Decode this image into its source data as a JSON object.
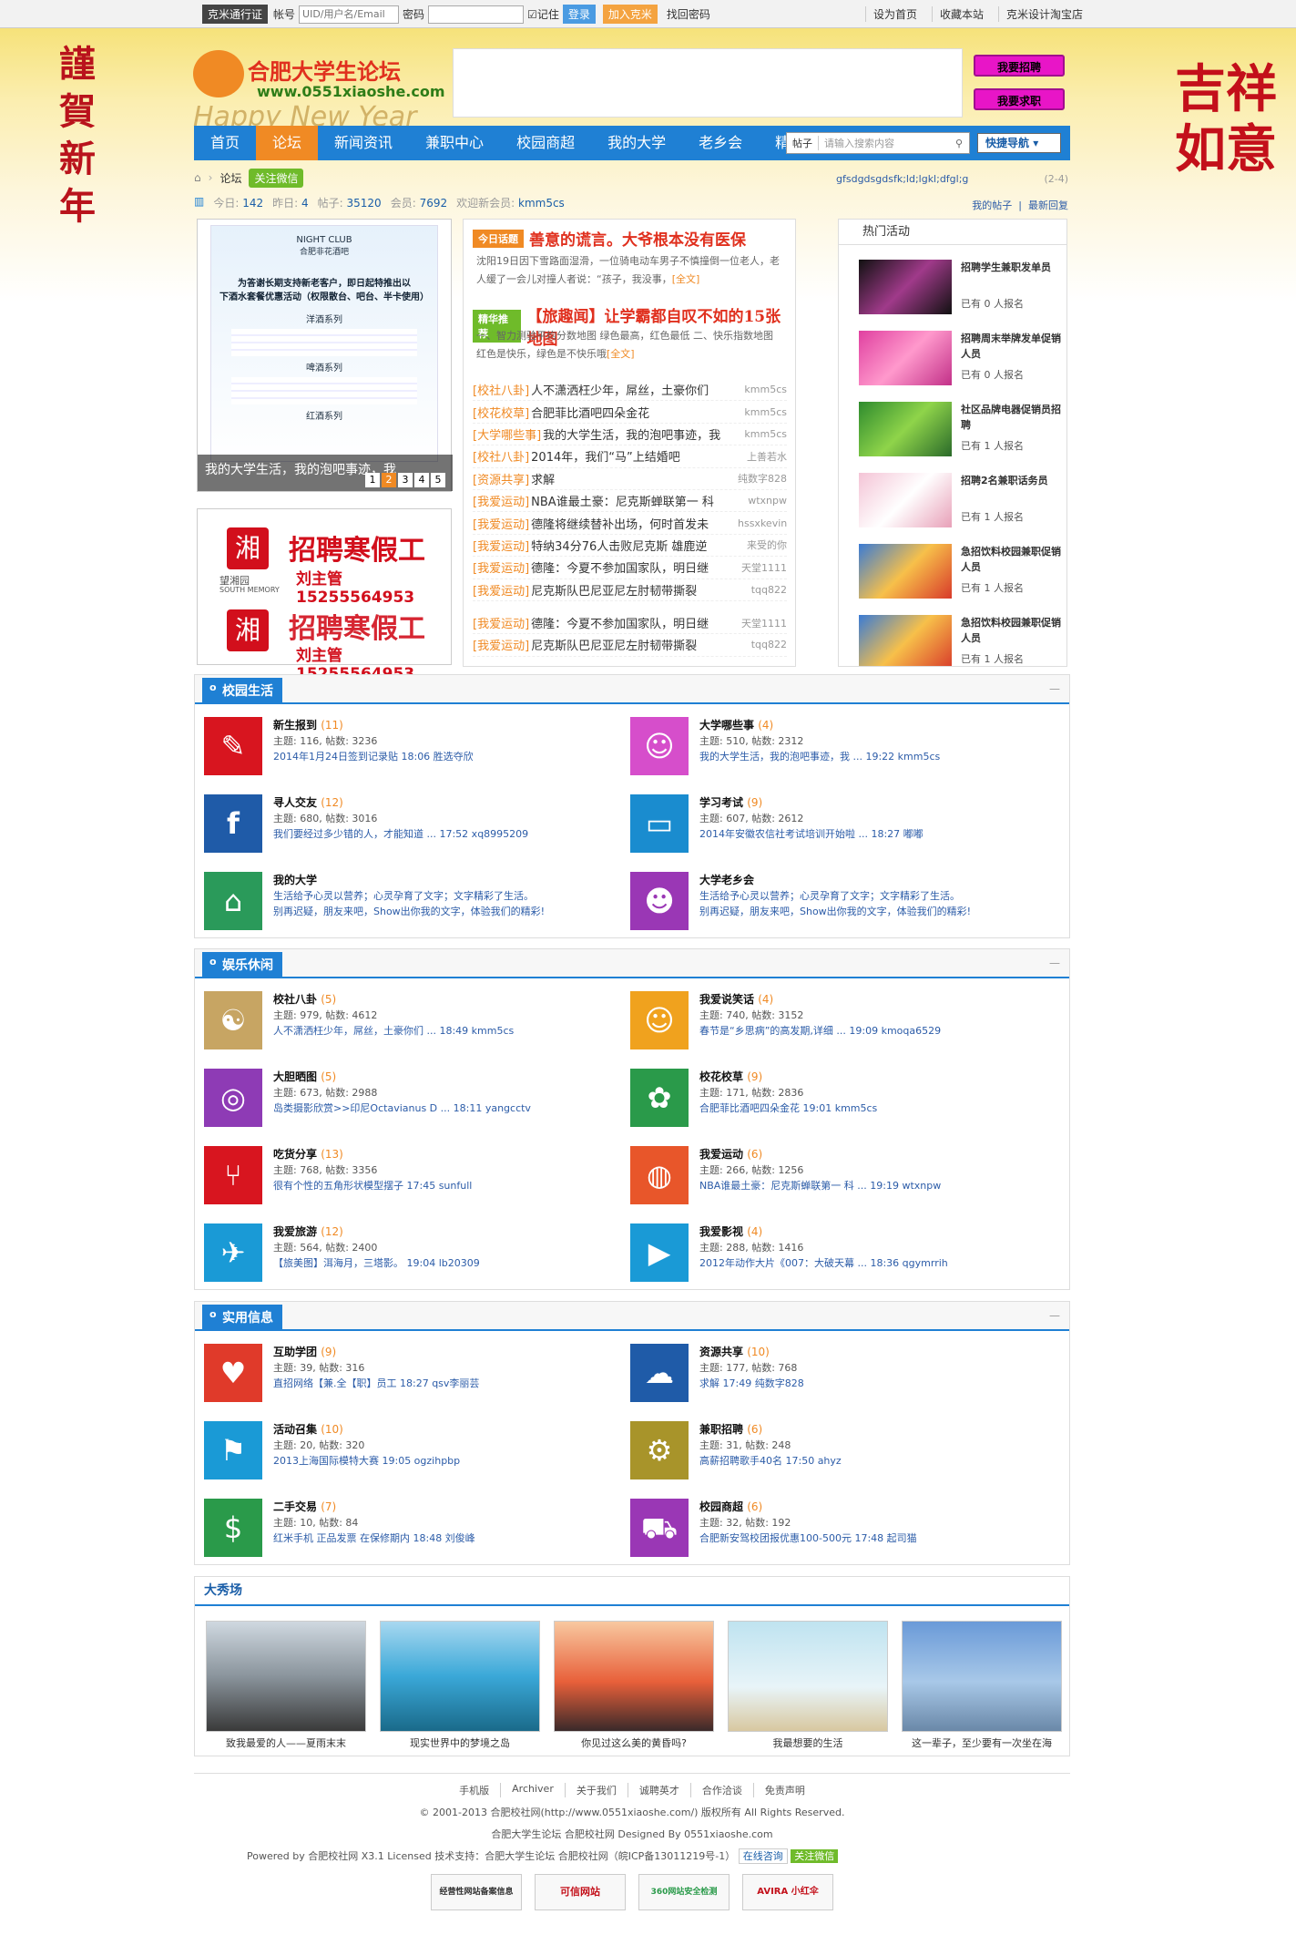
{
  "topbar": {
    "tag": "克米通行证",
    "account_label": "帐号",
    "account_placeholder": "UID/用户名/Email",
    "password_label": "密码",
    "remember": "记住",
    "login": "登录",
    "join": "加入克米",
    "find_password": "找回密码",
    "right_links": [
      "设为首页",
      "收藏本站",
      "克米设计淘宝店"
    ]
  },
  "header": {
    "logo_title": "合肥大学生论坛",
    "logo_url": "www.0551xiaoshe.com",
    "logo_happy": "Happy New Year",
    "hire_button": "我要招聘",
    "job_button": "我要求职",
    "left_deco": "謹賀新年",
    "right_deco": "吉祥如意"
  },
  "nav": {
    "items": [
      "首页",
      "论坛",
      "新闻资讯",
      "兼职中心",
      "校园商超",
      "我的大学",
      "老乡会",
      "精彩"
    ],
    "active": 1,
    "search_scope": "帖子",
    "search_placeholder": "请输入搜索内容",
    "quick_nav": "快捷导航"
  },
  "breadcrumb": {
    "current": "论坛",
    "wechat": "关注微信"
  },
  "stats": {
    "today_label": "今日:",
    "today": "142",
    "yesterday_label": "昨日:",
    "yesterday": "4",
    "posts_label": "帖子:",
    "posts": "35120",
    "members_label": "会员:",
    "members": "7692",
    "welcome": "欢迎新会员:",
    "new_member": "kmm5cs"
  },
  "right_top": {
    "notice": "gfsdgdsgdsfk;ld;lgkl;dfgl;g",
    "notice_date": "(2-4)",
    "links": [
      "我的帖子",
      "最新回复"
    ]
  },
  "slide": {
    "caption": "我的大学生活，我的泡吧事迹，我",
    "pages": [
      "1",
      "2",
      "3",
      "4",
      "5"
    ],
    "active": 1,
    "flyer_lines": [
      "NIGHT CLUB",
      "合肥非花酒吧",
      "为答谢长期支持新老客户，即日起特推出以",
      "下酒水套餐优惠活动（权限散台、吧台、半卡使用）",
      "洋酒系列",
      "啤酒系列",
      "红酒系列"
    ]
  },
  "ad": {
    "brand": "望湘园",
    "brand_en": "SOUTH MEMORY",
    "title": "招聘寒假工",
    "contact": "刘主管15255564953"
  },
  "hot": {
    "topic_tag": "今日话题",
    "topic_title": "善意的谎言。大爷根本没有医保",
    "topic_summary": "沈阳19日因下雪路面湿滑，一位骑电动车男子不慎撞倒一位老人，老人缓了一会儿对撞人者说：“孩子，我没事，",
    "full": "[全文]",
    "feature_tag": "精华推荐",
    "feature_title": "【旅趣闻】让学霸都自叹不如的15张地图",
    "feature_summary": "一、智力测验平均分数地图 绿色最高，红色最低 二、快乐指数地图 红色是快乐，绿色是不快乐哦",
    "list": [
      {
        "cat": "[校社八卦]",
        "title": "人不潇洒枉少年，屌丝，土豪你们",
        "author": "kmm5cs"
      },
      {
        "cat": "[校花校草]",
        "title": "合肥菲比酒吧四朵金花",
        "author": "kmm5cs"
      },
      {
        "cat": "[大学哪些事]",
        "title": "我的大学生活，我的泡吧事迹，我",
        "author": "kmm5cs"
      },
      {
        "cat": "[校社八卦]",
        "title": "2014年，我们“马”上结婚吧",
        "author": "上善若水"
      },
      {
        "cat": "[资源共享]",
        "title": "求解",
        "author": "纯数字828"
      },
      {
        "cat": "[我爱运动]",
        "title": "NBA谁最土豪：尼克斯蝉联第一 科",
        "author": "wtxnpw"
      },
      {
        "cat": "[我爱运动]",
        "title": "德隆将继续替补出场，何时首发未",
        "author": "hssxkevin"
      },
      {
        "cat": "[我爱运动]",
        "title": "特纳34分76人击败尼克斯 雄鹿逆",
        "author": "来受的你"
      },
      {
        "cat": "[我爱运动]",
        "title": "德隆：今夏不参加国家队，明日继",
        "author": "天堂1111"
      },
      {
        "cat": "[我爱运动]",
        "title": "尼克斯队巴尼亚尼左肘韧带撕裂",
        "author": "tqq822"
      },
      {
        "cat": "[我爱运动]",
        "title": "德隆：今夏不参加国家队，明日继",
        "author": "天堂1111"
      },
      {
        "cat": "[我爱运动]",
        "title": "尼克斯队巴尼亚尼左肘韧带撕裂",
        "author": "tqq822"
      }
    ]
  },
  "activities": {
    "title": "热门活动",
    "items": [
      {
        "name": "招聘学生兼职发单员",
        "count": "已有 0 人报名"
      },
      {
        "name": "招聘周末举牌发单促销人员",
        "count": "已有 0 人报名"
      },
      {
        "name": "社区品牌电器促销员招聘",
        "count": "已有 1 人报名"
      },
      {
        "name": "招聘2名兼职话务员",
        "count": "已有 1 人报名"
      },
      {
        "name": "急招饮料校园兼职促销人员",
        "count": "已有 1 人报名"
      },
      {
        "name": "急招饮料校园兼职促销人员",
        "count": "已有 1 人报名"
      }
    ]
  },
  "sections": [
    {
      "title": "校园生活",
      "forums": [
        {
          "name": "新生报到",
          "n": "(11)",
          "meta": "主题: 116, 帖数: 3236",
          "last": "2014年1月24日签到记录贴 18:06 胜选夺欣",
          "color": "#d8151f",
          "icon": "pen-icon"
        },
        {
          "name": "大学哪些事",
          "n": "(4)",
          "meta": "主题: 510, 帖数: 2312",
          "last": "我的大学生活，我的泡吧事迹，我 ... 19:22 kmm5cs",
          "color": "#d64ecb",
          "icon": "chat-icon"
        },
        {
          "name": "寻人交友",
          "n": "(12)",
          "meta": "主题: 680, 帖数: 3016",
          "last": "我们要经过多少错的人，才能知道 ... 17:52 xq8995209",
          "color": "#1f5ba8",
          "icon": "facebook-icon"
        },
        {
          "name": "学习考试",
          "n": "(9)",
          "meta": "主题: 607, 帖数: 2612",
          "last": "2014年安徽农信社考试培训开始啦 ... 18:27 嘟嘟",
          "color": "#1a8ccf",
          "icon": "book-icon"
        },
        {
          "name": "我的大学",
          "n": "",
          "meta": "生活给予心灵以营养；心灵孕育了文字；文字精彩了生活。",
          "last": "别再迟疑，朋友来吧，Show出你我的文字，体验我们的精彩!",
          "color": "#2a9a5a",
          "icon": "open-book-icon"
        },
        {
          "name": "大学老乡会",
          "n": "",
          "meta": "生活给予心灵以营养；心灵孕育了文字；文字精彩了生活。",
          "last": "别再迟疑，朋友来吧，Show出你我的文字，体验我们的精彩!",
          "color": "#9a37b5",
          "icon": "people-icon"
        }
      ]
    },
    {
      "title": "娱乐休闲",
      "forums": [
        {
          "name": "校社八卦",
          "n": "(5)",
          "meta": "主题: 979, 帖数: 4612",
          "last": "人不潇洒枉少年，屌丝，土豪你们 ... 18:49 kmm5cs",
          "color": "#c7a563",
          "icon": "yinyang-icon"
        },
        {
          "name": "我爱说笑话",
          "n": "(4)",
          "meta": "主题: 740, 帖数: 3152",
          "last": "春节是“乡思病”的高发期,详细 ... 19:09 kmoqa6529",
          "color": "#f0a21e",
          "icon": "smile-icon"
        },
        {
          "name": "大胆晒图",
          "n": "(5)",
          "meta": "主题: 673, 帖数: 2988",
          "last": "岛类摄影欣赏>>印尼Octavianus D ... 18:11 yangcctv",
          "color": "#8e3bb5",
          "icon": "camera-icon"
        },
        {
          "name": "校花校草",
          "n": "(9)",
          "meta": "主题: 171, 帖数: 2836",
          "last": "合肥菲比酒吧四朵金花 19:01 kmm5cs",
          "color": "#2a9a4a",
          "icon": "flower-icon"
        },
        {
          "name": "吃货分享",
          "n": "(13)",
          "meta": "主题: 768, 帖数: 3356",
          "last": "很有个性的五角形状模型摆子 17:45 sunfull",
          "color": "#d8151f",
          "icon": "fork-knife-icon"
        },
        {
          "name": "我爱运动",
          "n": "(6)",
          "meta": "主题: 266, 帖数: 1256",
          "last": "NBA谁最土豪：尼克斯蝉联第一 科 ... 19:19 wtxnpw",
          "color": "#e8562a",
          "icon": "basketball-icon"
        },
        {
          "name": "我爱旅游",
          "n": "(12)",
          "meta": "主题: 564, 帖数: 2400",
          "last": "【旅美图】洱海月，三塔影。 19:04 lb20309",
          "color": "#1a9ad6",
          "icon": "airplane-icon"
        },
        {
          "name": "我爱影视",
          "n": "(4)",
          "meta": "主题: 288, 帖数: 1416",
          "last": "2012年动作大片《007：大破天幕 ... 18:36 qgymrrih",
          "color": "#1a9ad6",
          "icon": "play-icon"
        }
      ]
    },
    {
      "title": "实用信息",
      "forums": [
        {
          "name": "互助学团",
          "n": "(9)",
          "meta": "主题: 39, 帖数: 316",
          "last": "直招网络【兼.全【职】员工 18:27 qsv李丽芸",
          "color": "#e03a2a",
          "icon": "heart-icon"
        },
        {
          "name": "资源共享",
          "n": "(10)",
          "meta": "主题: 177, 帖数: 768",
          "last": "求解 17:49 纯数字828",
          "color": "#1f5ba8",
          "icon": "cloud-icon"
        },
        {
          "name": "活动召集",
          "n": "(10)",
          "meta": "主题: 20, 帖数: 320",
          "last": "2013上海国际模特大赛 19:05 ogzihpbp",
          "color": "#1a9ad6",
          "icon": "flag-icon"
        },
        {
          "name": "兼职招聘",
          "n": "(6)",
          "meta": "主题: 31, 帖数: 248",
          "last": "高薪招聘歌手40名 17:50 ahyz",
          "color": "#a8942a",
          "icon": "gear-icon"
        },
        {
          "name": "二手交易",
          "n": "(7)",
          "meta": "主题: 10, 帖数: 84",
          "last": "红米手机 正品发票 在保修期内 18:48 刘俊峰",
          "color": "#2a9a4a",
          "icon": "money-bag-icon"
        },
        {
          "name": "校园商超",
          "n": "(6)",
          "meta": "主题: 32, 帖数: 192",
          "last": "合肥新安驾校团报优惠100-500元 17:48 起司猫",
          "color": "#9a37b5",
          "icon": "cart-icon"
        }
      ]
    }
  ],
  "show": {
    "title": "大秀场",
    "pics": [
      {
        "cap": "致我最爱的人——夏雨末末"
      },
      {
        "cap": "现实世界中的梦境之岛"
      },
      {
        "cap": "你见过这么美的黄昏吗?"
      },
      {
        "cap": "我最想要的生活"
      },
      {
        "cap": "这一辈子，至少要有一次坐在海"
      }
    ]
  },
  "footer": {
    "links": [
      "手机版",
      "Archiver",
      "关于我们",
      "诚聘英才",
      "合作洽谈",
      "免责声明"
    ],
    "copyright": "© 2001-2013 合肥校社网(http://www.0551xiaoshe.com/) 版权所有 All Rights Reserved.",
    "designed": "合肥大学生论坛 合肥校社网 Designed By 0551xiaoshe.com",
    "powered": "Powered by 合肥校社网 X3.1 Licensed 技术支持：合肥大学生论坛 合肥校社网（皖ICP备13011219号-1）",
    "online": "在线咨询",
    "wechat": "关注微信",
    "badges": [
      "经营性网站备案信息",
      "可信网站",
      "360网站安全检测",
      "AVIRA 小红伞"
    ]
  }
}
